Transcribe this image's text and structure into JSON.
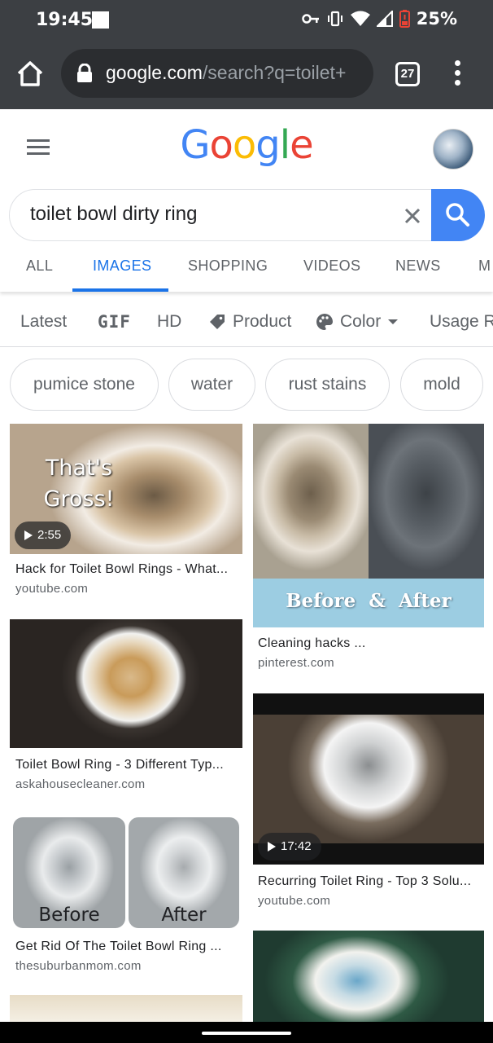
{
  "status_bar": {
    "time": "19:45",
    "battery": "25%"
  },
  "browser": {
    "url_host": "google.com",
    "url_path": "/search?q=toilet+",
    "tab_count": "27"
  },
  "logo": [
    "G",
    "o",
    "o",
    "g",
    "l",
    "e"
  ],
  "search": {
    "query": "toilet bowl dirty ring"
  },
  "tabs": [
    {
      "label": "ALL"
    },
    {
      "label": "IMAGES",
      "active": true
    },
    {
      "label": "SHOPPING"
    },
    {
      "label": "VIDEOS"
    },
    {
      "label": "NEWS"
    },
    {
      "label": "M"
    }
  ],
  "filters": {
    "latest": "Latest",
    "gif": "GIF",
    "hd": "HD",
    "product": "Product",
    "color": "Color",
    "usage": "Usage R"
  },
  "chips": [
    "pumice stone",
    "water",
    "rust stains",
    "mold"
  ],
  "results": [
    {
      "title": "Hack for Toilet Bowl Rings - What...",
      "source": "youtube.com",
      "duration": "2:55",
      "overlay": "That's Gross!"
    },
    {
      "title": "Cleaning hacks ...",
      "source": "pinterest.com",
      "overlay": "Before  &  After"
    },
    {
      "title": "Toilet Bowl Ring - 3 Different Typ...",
      "source": "askahousecleaner.com"
    },
    {
      "title": "Recurring Toilet Ring - Top 3 Solu...",
      "source": "youtube.com",
      "duration": "17:42"
    },
    {
      "title": "Get Rid Of The Toilet Bowl Ring ...",
      "source": "thesuburbanmom.com",
      "overlay_left": "Before",
      "overlay_right": "After"
    }
  ],
  "colors": {
    "blue": "#4285f4",
    "red": "#ea4335",
    "yellow": "#fbbc05",
    "green": "#34a853",
    "active_tab": "#1a73e8",
    "chrome_bar": "#3c3f43"
  }
}
